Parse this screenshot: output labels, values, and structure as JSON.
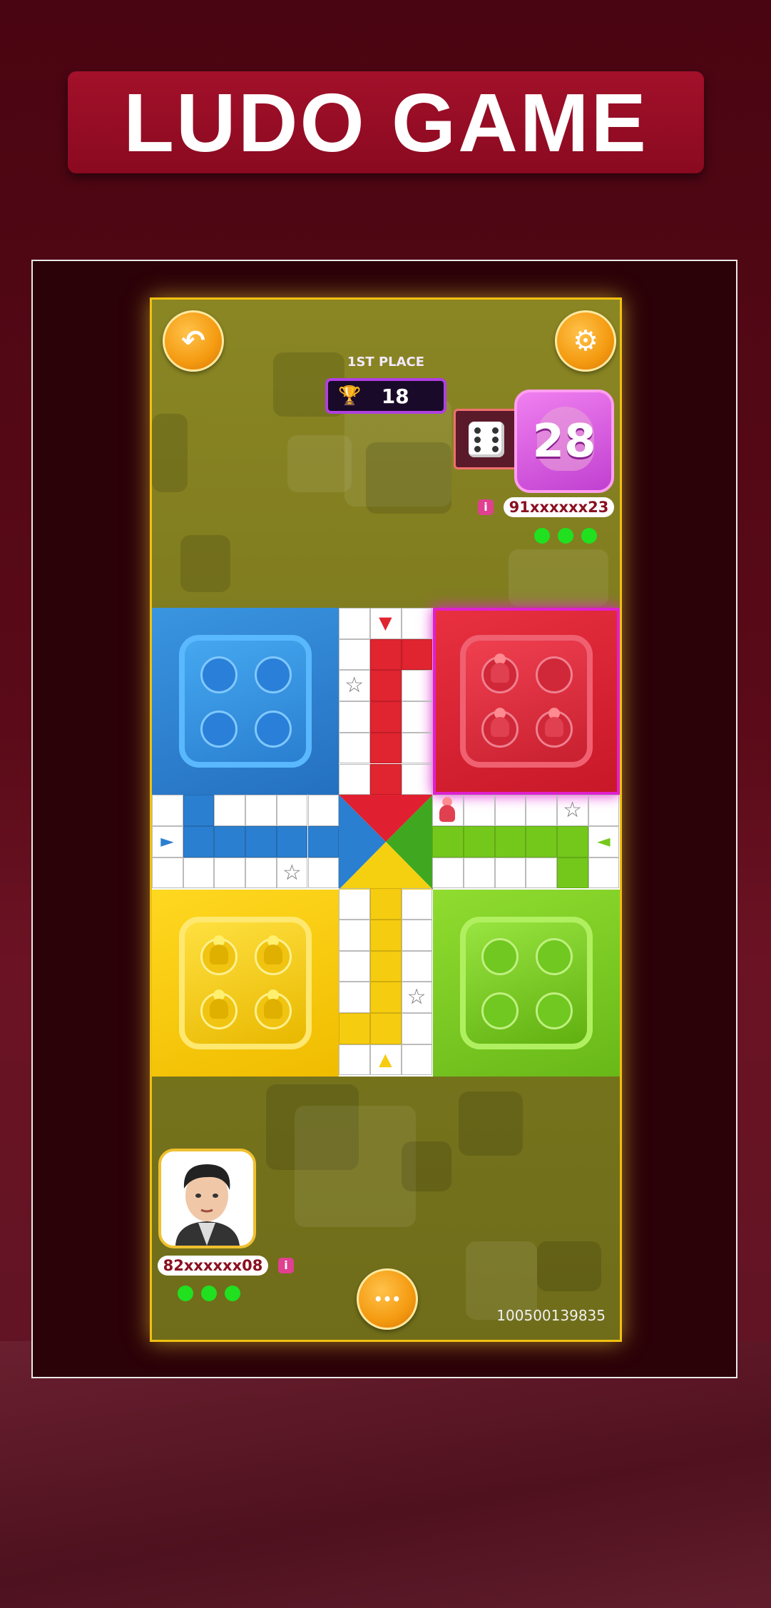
{
  "banner": {
    "title": "LUDO GAME"
  },
  "top": {
    "back_icon": "back-arrow-icon",
    "settings_icon": "gear-icon"
  },
  "leaderboard": {
    "place_label": "1ST PLACE",
    "score": "18"
  },
  "opponent": {
    "timer": "28",
    "username": "91xxxxxx23",
    "info_label": "i",
    "lives": 3
  },
  "player": {
    "username": "82xxxxxx08",
    "info_label": "i",
    "lives": 3
  },
  "chat": {
    "icon": "chat-bubble-icon",
    "glyph": "•••"
  },
  "game_id": "100500139835",
  "colors": {
    "blue": "#2b7fd0",
    "red": "#e02430",
    "yellow": "#f5cc10",
    "green": "#74c81c",
    "highlight": "#d020c0"
  }
}
